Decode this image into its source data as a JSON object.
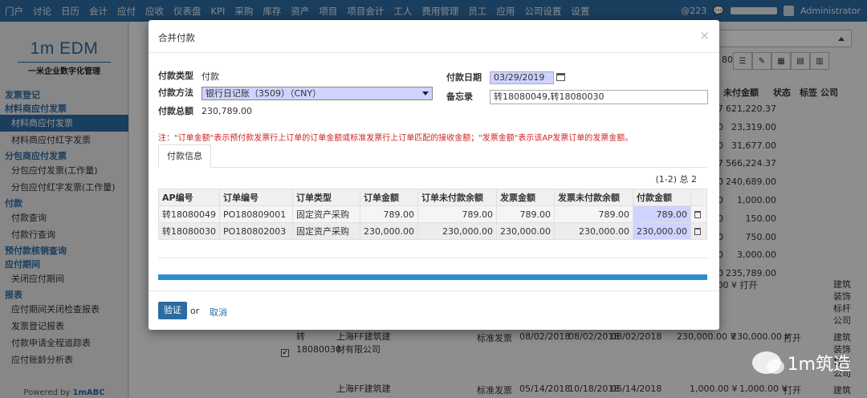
{
  "nav": {
    "items": [
      "门户",
      "讨论",
      "日历",
      "会计",
      "应付",
      "应收",
      "仪表盘",
      "KPI",
      "采购",
      "库存",
      "资产",
      "项目",
      "项目会计",
      "工人",
      "费用管理",
      "员工",
      "应用",
      "公司设置",
      "设置"
    ],
    "notif_count": "@223",
    "user": "Administrator",
    "progress_pct": 60
  },
  "sidebar": {
    "brand": "1m EDM",
    "tagline": "一米企业数字化管理",
    "menu": [
      {
        "type": "group",
        "label": "发票登记"
      },
      {
        "type": "group",
        "label": "材料商应付发票"
      },
      {
        "type": "item",
        "label": "材料商应付发票",
        "active": true
      },
      {
        "type": "item",
        "label": "材料商应付红字发票"
      },
      {
        "type": "group",
        "label": "分包商应付发票"
      },
      {
        "type": "item",
        "label": "分包应付发票(工作量)"
      },
      {
        "type": "item",
        "label": "分包应付红字发票(工作量)"
      },
      {
        "type": "group",
        "label": "付款"
      },
      {
        "type": "item",
        "label": "付款查询"
      },
      {
        "type": "item",
        "label": "付款行查询"
      },
      {
        "type": "group",
        "label": "预付款核销查询"
      },
      {
        "type": "group",
        "label": "应付期间"
      },
      {
        "type": "item",
        "label": "关闭应付期间"
      },
      {
        "type": "group",
        "label": "报表"
      },
      {
        "type": "item",
        "label": "应付期间关闭检查报表"
      },
      {
        "type": "item",
        "label": "发票登记报表"
      },
      {
        "type": "item",
        "label": "付款申请全程追踪表"
      },
      {
        "type": "item",
        "label": "应付账龄分析表"
      }
    ],
    "powered_prefix": "Powered by ",
    "powered_brand": "1mABC"
  },
  "background": {
    "page_num": "80",
    "headers": [
      "未付金额",
      "状态",
      "标签",
      "公司"
    ],
    "amounts": [
      "621,220.37",
      "23,319.00",
      "31,677.00",
      "566,224.37",
      "240,689.00",
      "1,000.00",
      "150.00",
      "750.00",
      "3,000.00",
      "235,789.00"
    ],
    "partial_prefixes": [
      "37",
      "00",
      "00",
      "37",
      "00",
      "00",
      "00",
      "00",
      "00",
      "00"
    ],
    "row1": {
      "amount": "789.00 ¥",
      "status": "打开",
      "company": "建筑装饰标杆公司"
    },
    "row2": {
      "ap": "转18080030",
      "supplier": "上海FF建筑建材有限公司",
      "type": "标准发票",
      "d1": "08/02/2018",
      "d2": "08/02/2018",
      "d3": "08/02/2018",
      "a1": "230,000.00 ¥",
      "a2": "230,000.00 ¥",
      "status": "打开",
      "company": "建筑装饰标杆公司"
    },
    "row3": {
      "supplier": "上海FF建筑建",
      "type": "标准发票",
      "d1": "05/14/2018",
      "d2": "10/18/2018",
      "d3": "05/14/2018",
      "a1": "1,000.00 ¥",
      "a2": "1,000.00 ¥",
      "status": "打开",
      "company": "建筑"
    }
  },
  "modal": {
    "title": "合并付款",
    "close": "×",
    "labels": {
      "pay_type": "付款类型",
      "pay_method": "付款方法",
      "pay_total": "付款总额",
      "pay_date": "付款日期",
      "memo": "备忘录"
    },
    "values": {
      "pay_type": "付款",
      "pay_method": "银行日记账（3509）（CNY）",
      "pay_total": "230,789.00",
      "pay_date": "03/29/2019",
      "memo": "转18080049,转18080030"
    },
    "note": "注：\"订单金额\"表示预付款发票行上订单的订单金额或标准发票行上订单匹配的接收金额；\"发票金额\"表示该AP发票订单的发票金额。",
    "tab": "付款信息",
    "page_info": "(1-2) 总 2",
    "columns": [
      "AP编号",
      "订单编号",
      "订单类型",
      "订单金额",
      "订单未付款余额",
      "发票金额",
      "发票未付款余额",
      "付款金额"
    ],
    "rows": [
      [
        "转18080049",
        "PO180809001",
        "固定资产采购",
        "789.00",
        "789.00",
        "789.00",
        "789.00",
        "789.00"
      ],
      [
        "转18080030",
        "PO180802003",
        "固定资产采购",
        "230,000.00",
        "230,000.00",
        "230,000.00",
        "230,000.00",
        "230,000.00"
      ]
    ],
    "verify": "验证",
    "or": "or",
    "cancel": "取消"
  },
  "watermark": "1m筑造",
  "colors": {
    "brand": "#2d6ca2",
    "highlight": "#cfd3ff",
    "note": "#d0231f"
  }
}
